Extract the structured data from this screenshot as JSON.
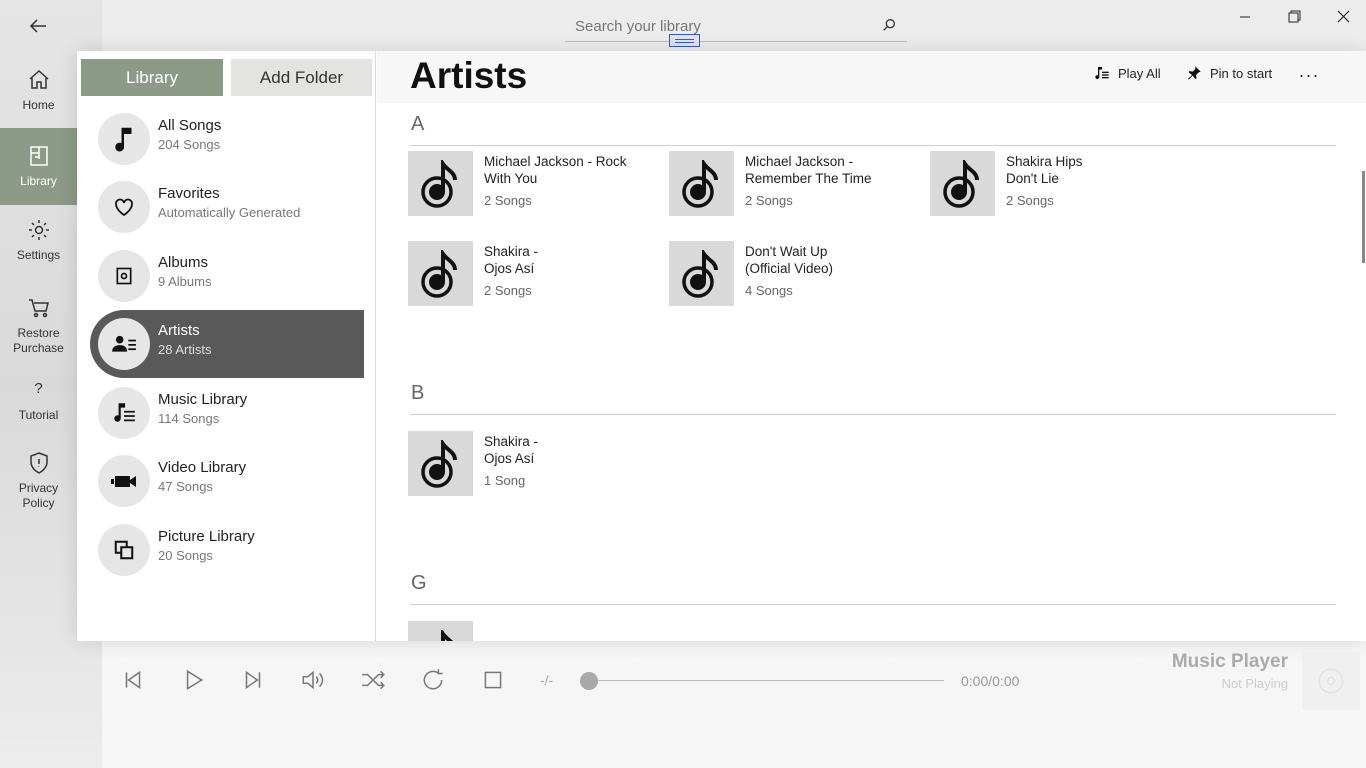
{
  "search": {
    "placeholder": "Search your library"
  },
  "nav": {
    "items": [
      {
        "label": "Home",
        "icon": "home-icon"
      },
      {
        "label": "Library",
        "icon": "library-icon"
      },
      {
        "label": "Settings",
        "icon": "gear-icon"
      },
      {
        "label": "Restore Purchase",
        "icon": "cart-icon"
      },
      {
        "label": "Tutorial",
        "icon": "question-icon"
      },
      {
        "label": "Privacy Policy",
        "icon": "shield-icon"
      }
    ],
    "active": "Library"
  },
  "tabs": {
    "library": "Library",
    "add_folder": "Add Folder"
  },
  "categories": [
    {
      "title": "All Songs",
      "sub": "204 Songs",
      "icon": "music-note-icon"
    },
    {
      "title": "Favorites",
      "sub": "Automatically Generated",
      "icon": "heart-icon"
    },
    {
      "title": "Albums",
      "sub": "9 Albums",
      "icon": "album-icon"
    },
    {
      "title": "Artists",
      "sub": "28 Artists",
      "icon": "artist-icon"
    },
    {
      "title": "Music Library",
      "sub": "114 Songs",
      "icon": "playlist-icon"
    },
    {
      "title": "Video Library",
      "sub": "47 Songs",
      "icon": "video-camera-icon"
    },
    {
      "title": "Picture Library",
      "sub": "20 Songs",
      "icon": "picture-icon"
    }
  ],
  "main": {
    "title": "Artists",
    "play_all": "Play All",
    "pin_to_start": "Pin to start",
    "more": "...",
    "sections": [
      {
        "letter": "A",
        "artists": [
          {
            "name": "Michael Jackson - Rock With You",
            "count": "2 Songs"
          },
          {
            "name": "Michael Jackson - Remember The Time",
            "count": "2 Songs"
          },
          {
            "name": "Shakira Hips Don't Lie",
            "count": "2 Songs"
          },
          {
            "name": "Shakira - Ojos Así",
            "count": "2 Songs"
          },
          {
            "name": "Don't Wait Up (Official Video)",
            "count": "4 Songs"
          }
        ]
      },
      {
        "letter": "B",
        "artists": [
          {
            "name": "Shakira - Ojos Así",
            "count": "1 Song"
          }
        ]
      },
      {
        "letter": "G",
        "artists": []
      }
    ]
  },
  "player": {
    "separator": "-/-",
    "time": "0:00/0:00",
    "title": "Music Player",
    "status": "Not Playing",
    "progress": 0
  },
  "colors": {
    "accent": "#8d9a88",
    "active_item": "#595959"
  }
}
